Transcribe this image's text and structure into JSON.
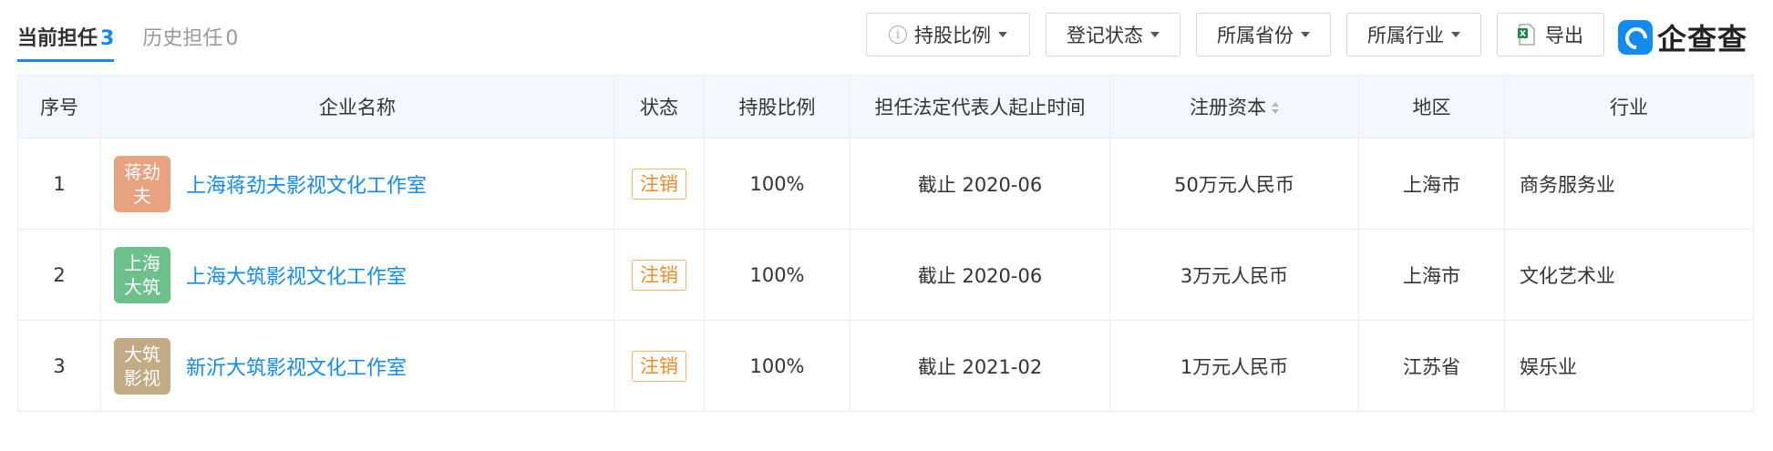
{
  "tabs": [
    {
      "label": "当前担任",
      "count": "3"
    },
    {
      "label": "历史担任",
      "count": "0"
    }
  ],
  "filters": {
    "shareholding": "持股比例",
    "reg_status": "登记状态",
    "province": "所属省份",
    "industry": "所属行业",
    "export": "导出"
  },
  "logo": {
    "text": "企查查",
    "color": "#128bed"
  },
  "table": {
    "headers": {
      "index": "序号",
      "company": "企业名称",
      "status": "状态",
      "share": "持股比例",
      "period": "担任法定代表人起止时间",
      "capital": "注册资本",
      "region": "地区",
      "industry": "行业"
    },
    "rows": [
      {
        "index": "1",
        "avatar": "蒋劲夫",
        "avatar_color": "#e7a27f",
        "name": "上海蒋劲夫影视文化工作室",
        "status": "注销",
        "share": "100%",
        "period": "截止 2020-06",
        "capital": "50万元人民币",
        "region": "上海市",
        "industry": "商务服务业"
      },
      {
        "index": "2",
        "avatar": "上海大筑",
        "avatar_color": "#6cc08b",
        "name": "上海大筑影视文化工作室",
        "status": "注销",
        "share": "100%",
        "period": "截止 2020-06",
        "capital": "3万元人民币",
        "region": "上海市",
        "industry": "文化艺术业"
      },
      {
        "index": "3",
        "avatar": "大筑影视",
        "avatar_color": "#c2aa85",
        "name": "新沂大筑影视文化工作室",
        "status": "注销",
        "share": "100%",
        "period": "截止 2021-02",
        "capital": "1万元人民币",
        "region": "江苏省",
        "industry": "娱乐业"
      }
    ]
  },
  "colors": {
    "accent": "#128bed",
    "status": "#f08b24"
  }
}
